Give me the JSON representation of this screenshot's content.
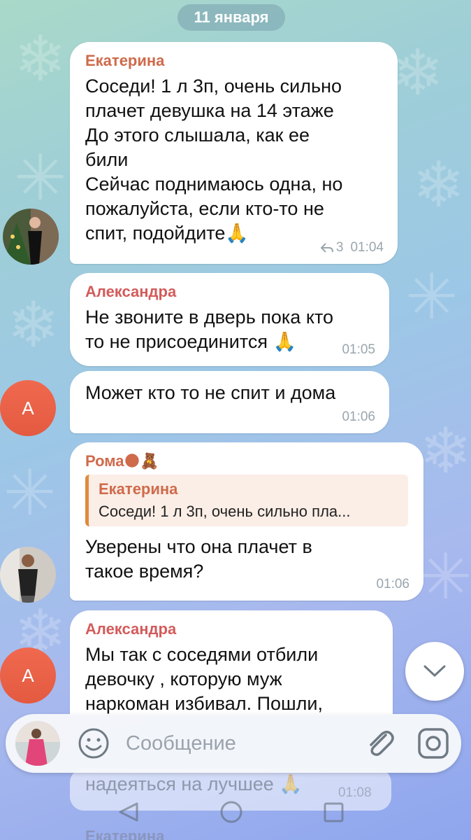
{
  "date_separator": "11 января",
  "messages": [
    {
      "sender": "Екатерина",
      "text": "Соседи! 1 л 3п, очень сильно\nплачет девушка на 14 этаже\nДо этого слышала, как ее\nбили\nСейчас поднимаюсь одна, но\nпожалуйста, если кто-то не\nспит, подойдите🙏",
      "reply_count": "3",
      "time": "01:04"
    },
    {
      "sender": "Александра",
      "text": "Не звоните в дверь пока кто\nто не присоединится 🙏",
      "time": "01:05"
    },
    {
      "text": "Может кто то не спит и дома",
      "time": "01:06",
      "avatar_letter": "А"
    },
    {
      "sender": "Рома🌑🧸",
      "quote_name": "Екатерина",
      "quote_text": "Соседи! 1 л 3п, очень сильно пла...",
      "text": "Уверены что она плачет в\nтакое время?",
      "time": "01:06"
    },
    {
      "sender": "Александра",
      "text": "Мы так с соседями отбили\nдевочку , которую муж\nнаркоман избивал. Пошли,",
      "avatar_letter": "А"
    }
  ],
  "peek": {
    "text": "надеяться на лучшее 🙏",
    "time": "01:08",
    "sender": "Екатерина"
  },
  "composer": {
    "placeholder": "Сообщение"
  },
  "icons": [
    "reply-arrow-icon",
    "chevron-down-icon",
    "emoji-icon",
    "attach-icon",
    "camera-icon",
    "nav-back-icon",
    "nav-home-icon",
    "nav-recents-icon"
  ]
}
